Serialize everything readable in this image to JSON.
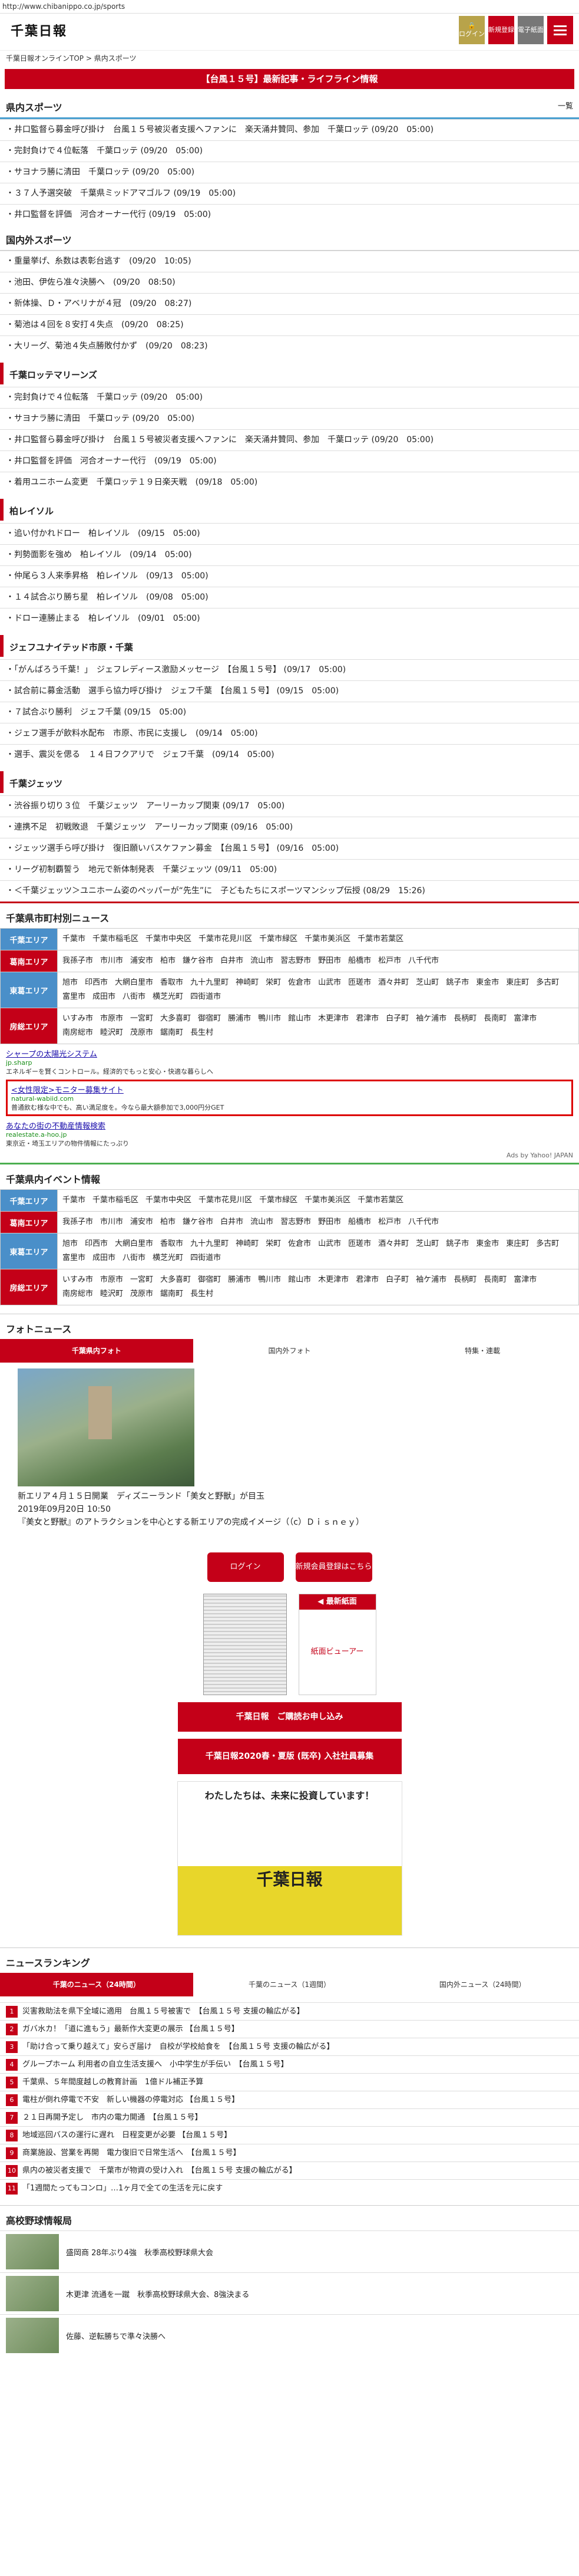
{
  "url": "http://www.chibanippo.co.jp/sports",
  "header": {
    "logo": "千葉日報",
    "login": "ログイン",
    "register": "新規登録",
    "paper": "電子紙面"
  },
  "breadcrumb": "千葉日報オンラインTOP > 県内スポーツ",
  "alert": "【台風１５号】最新記事・ライフライン情報",
  "prefectural_sports": {
    "title": "県内スポーツ",
    "more": "一覧",
    "items": [
      "井口監督ら募金呼び掛け　台風１５号被災者支援へファンに　楽天涌井贊同、参加　千葉ロッテ (09/20　05:00)",
      "完封負けで４位転落　千葉ロッテ (09/20　05:00)",
      "サヨナラ勝に清田　千葉ロッテ (09/20　05:00)",
      "３７人予選突破　千葉県ミッドアマゴルフ (09/19　05:00)",
      "井口監督を評価　河合オーナー代行 (09/19　05:00)"
    ]
  },
  "national_sports": {
    "title": "国内外スポーツ",
    "items": [
      "重量挙げ、糸数は表彰台逃す　(09/20　10:05)",
      "池田、伊佐ら准々決勝へ　(09/20　08:50)",
      "新体操、Ｄ・アベリナが４冠　(09/20　08:27)",
      "菊池は４回を８安打４失点　(09/20　08:25)",
      "大リーグ、菊池４失点勝敗付かず　(09/20　08:23)"
    ]
  },
  "marines": {
    "title": "千葉ロッテマリーンズ",
    "items": [
      "完封負けで４位転落　千葉ロッテ (09/20　05:00)",
      "サヨナラ勝に清田　千葉ロッテ (09/20　05:00)",
      "井口監督ら募金呼び掛け　台風１５号被災者支援へファンに　楽天涌井贊同、参加　千葉ロッテ (09/20　05:00)",
      "井口監督を評価　河合オーナー代行　(09/19　05:00)",
      "着用ユニホーム変更　千葉ロッテ１９日楽天戦　(09/18　05:00)"
    ]
  },
  "reysol": {
    "title": "柏レイソル",
    "items": [
      "追い付かれドロー　柏レイソル　(09/15　05:00)",
      "判勢面影を強め　柏レイソル　(09/14　05:00)",
      "仲尾ら３人来季昇格　柏レイソル　(09/13　05:00)",
      "１４試合ぶり勝ち星　柏レイソル　(09/08　05:00)",
      "ドロー連勝止まる　柏レイソル　(09/01　05:00)"
    ]
  },
  "jef": {
    "title": "ジェフユナイテッド市原・千葉",
    "items": [
      "「がんばろう千葉！」　ジェフレディース激励メッセージ　【台風１５号】 (09/17　05:00)",
      "試合前に募金活動　選手ら協力呼び掛け　ジェフ千葉　【台風１５号】 (09/15　05:00)",
      "７試合ぶり勝利　ジェフ千葉 (09/15　05:00)",
      "ジェフ選手が飲料水配布　市原、市民に支援し　(09/14　05:00)",
      "選手、震災を偲る　１４日フクアリで　ジェフ千葉　(09/14　05:00)"
    ]
  },
  "jets": {
    "title": "千葉ジェッツ",
    "items": [
      "渋谷振り切り３位　千葉ジェッツ　アーリーカップ関東 (09/17　05:00)",
      "連携不足　初戦敗退　千葉ジェッツ　アーリーカップ関東 (09/16　05:00)",
      "ジェッツ選手ら呼び掛け　復旧願いバスケファン募金　【台風１５号】 (09/16　05:00)",
      "リーグ初制覇誓う　地元で新体制発表　千葉ジェッツ (09/11　05:00)",
      "＜千葉ジェッツ＞ユニホーム姿のペッパーが“先生”に　子どもたちにスポーツマンシップ伝授 (08/29　15:26)"
    ]
  },
  "city_news": {
    "title": "千葉県市町村別ニュース",
    "regions": [
      {
        "label": "千葉エリア",
        "cities": [
          "千葉市",
          "千葉市稲毛区",
          "千葉市中央区",
          "千葉市花見川区",
          "千葉市緑区",
          "千葉市美浜区",
          "千葉市若葉区"
        ]
      },
      {
        "label": "葛南エリア",
        "cities": [
          "我孫子市",
          "市川市",
          "浦安市",
          "柏市",
          "鎌ケ谷市",
          "白井市",
          "流山市",
          "習志野市",
          "野田市",
          "船橋市",
          "松戸市",
          "八千代市"
        ]
      },
      {
        "label": "東葛エリア",
        "cities": [
          "旭市",
          "印西市",
          "大網白里市",
          "香取市",
          "九十九里町",
          "神崎町",
          "栄町",
          "佐倉市",
          "山武市",
          "匝瑳市",
          "酒々井町",
          "芝山町",
          "銚子市",
          "東金市",
          "東庄町",
          "多古町",
          "富里市",
          "成田市",
          "八街市",
          "横芝光町",
          "四街道市"
        ]
      },
      {
        "label": "房総エリア",
        "cities": [
          "いすみ市",
          "市原市",
          "一宮町",
          "大多喜町",
          "御宿町",
          "勝浦市",
          "鴨川市",
          "館山市",
          "木更津市",
          "君津市",
          "白子町",
          "袖ケ浦市",
          "長柄町",
          "長南町",
          "富津市",
          "南房総市",
          "睦沢町",
          "茂原市",
          "鋸南町",
          "長生村"
        ]
      }
    ]
  },
  "ads": {
    "items": [
      {
        "title": "シャープの太陽光システム",
        "url": "jp.sharp",
        "desc": "エネルギーを賢くコントロール。経済的でもっと安心・快適な暮らしへ"
      },
      {
        "title": "<女性限定>モニター募集サイト",
        "url": "natural-wabiid.com",
        "desc": "普通飲む様な中でも、高い満足度を。今なら最大額参加で3,000円分GET"
      },
      {
        "title": "あなたの街の不動産情報検索",
        "url": "realestate.a-hoo.jp",
        "desc": "東京近・埼玉エリアの物件情報にたっぷり"
      }
    ],
    "footer": "Ads by Yahoo! JAPAN"
  },
  "events": {
    "title": "千葉県内イベント情報",
    "regions": [
      {
        "label": "千葉エリア",
        "cities": [
          "千葉市",
          "千葉市稲毛区",
          "千葉市中央区",
          "千葉市花見川区",
          "千葉市緑区",
          "千葉市美浜区",
          "千葉市若葉区"
        ]
      },
      {
        "label": "葛南エリア",
        "cities": [
          "我孫子市",
          "市川市",
          "浦安市",
          "柏市",
          "鎌ケ谷市",
          "白井市",
          "流山市",
          "習志野市",
          "野田市",
          "船橋市",
          "松戸市",
          "八千代市"
        ]
      },
      {
        "label": "東葛エリア",
        "cities": [
          "旭市",
          "印西市",
          "大網白里市",
          "香取市",
          "九十九里町",
          "神崎町",
          "栄町",
          "佐倉市",
          "山武市",
          "匝瑳市",
          "酒々井町",
          "芝山町",
          "銚子市",
          "東金市",
          "東庄町",
          "多古町",
          "富里市",
          "成田市",
          "八街市",
          "横芝光町",
          "四街道市"
        ]
      },
      {
        "label": "房総エリア",
        "cities": [
          "いすみ市",
          "市原市",
          "一宮町",
          "大多喜町",
          "御宿町",
          "勝浦市",
          "鴨川市",
          "館山市",
          "木更津市",
          "君津市",
          "白子町",
          "袖ケ浦市",
          "長柄町",
          "長南町",
          "富津市",
          "南房総市",
          "睦沢町",
          "茂原市",
          "鋸南町",
          "長生村"
        ]
      }
    ]
  },
  "photo_news": {
    "title": "フォトニュース",
    "tabs": [
      "千葉県内フォト",
      "国内外フォト",
      "特集・連載"
    ],
    "caption_title": "新エリア４月１５日開業　ディズニーランド「美女と野獣」が目玉",
    "caption_date": "2019年09月20日 10:50",
    "caption_desc": "『美女と野獣』のアトラクションを中心とする新エリアの完成イメージ（（c）Ｄｉｓｎｅｙ）"
  },
  "member": {
    "login": "ログイン",
    "register": "新規会員登録はこちら",
    "latest_paper": "◀ 最新紙面",
    "viewer": "紙面ビューアー"
  },
  "banners": {
    "b1": "千葉日報　ご購読お申し込み",
    "b2": "千葉日報2020春・夏版 (既卒) 入社社員募集",
    "b3_text": "わたしたちは、未来に投資しています！",
    "b3_big": "千葉日報"
  },
  "ranking": {
    "title": "ニュースランキング",
    "tabs": [
      "千葉のニュース（24時間）",
      "千葉のニュース（1週間）",
      "国内外ニュース（24時間）"
    ],
    "items": [
      "災害救助法を県下全域に適用　台風１５号被害で　【台風１５号 支援の輪広がる】",
      "ガバ水カ！「道に進もう」最新作大変更の展示 【台風１５号】",
      "「助け合って乗り越えて」安らぎ届け　自校が学校給食を　【台風１５号 支援の輪広がる】",
      "グループホーム 利用者の自立生活支援へ　小中学生が手伝い　【台風１５号】",
      "千葉県、５年間度越しの教育計画　1億ドル補正予算",
      "電柱が倒れ停電で不安　新しい機器の停電対応 【台風１５号】",
      "２１日再開予定し　市内の電力開通　【台風１５号】",
      "地域巡回バスの運行に遅れ　日程変更が必要 【台風１５号】",
      "商業施設、営業を再開　電力復旧で日常生活へ　【台風１５号】",
      "県内の被災者支援で　千葉市が物資の受け入れ　【台風１５号 支援の輪広がる】",
      "「1週間たってもコンロ」…1ヶ月で全ての生活を元に戻す"
    ]
  },
  "highschool": {
    "title": "高校野球情報局",
    "items": [
      "盛岡商 28年ぶり4強　秋季高校野球県大会",
      "木更津 流通を一蹴　秋季高校野球県大会、8強決まる",
      "佐藤、逆転勝ちで準々決勝へ"
    ]
  }
}
